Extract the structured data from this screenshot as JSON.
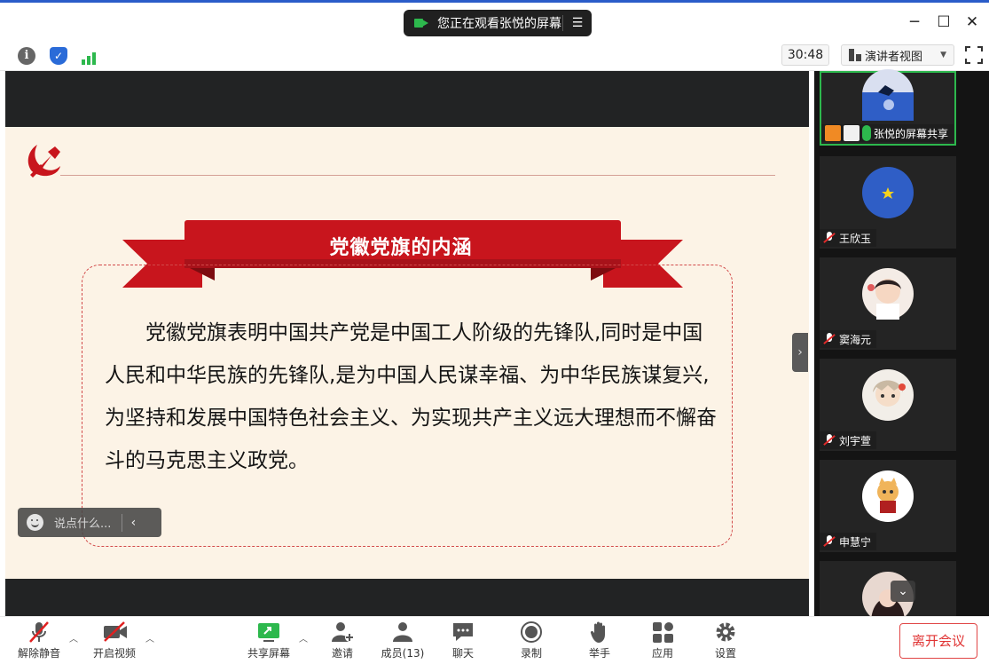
{
  "titlebar": {
    "share_banner": "您正在观看张悦的屏幕",
    "menu_icon": "menu-icon",
    "window_controls": [
      "minimize-icon",
      "maximize-icon",
      "close-icon"
    ]
  },
  "infobar": {
    "icons": [
      "info-icon",
      "shield-icon",
      "signal-icon"
    ],
    "elapsed": "30:48",
    "view_mode": "演讲者视图",
    "fullscreen_icon": "fullscreen-icon"
  },
  "slide": {
    "title": "党徽党旗的内涵",
    "body": "　　党徽党旗表明中国共产党是中国工人阶级的先锋队,同时是中国人民和中华民族的先锋队,是为中国人民谋幸福、为中华民族谋复兴,为坚持和发展中国特色社会主义、为实现共产主义远大理想而不懈奋斗的马克思主义政党。",
    "accent_color": "#c8151d"
  },
  "chat": {
    "placeholder": "说点什么..."
  },
  "participants": [
    {
      "name": "张悦的屏幕共享",
      "sharing": true
    },
    {
      "name": "王欣玉",
      "muted": true
    },
    {
      "name": "窦海元",
      "muted": true
    },
    {
      "name": "刘宇萱",
      "muted": true
    },
    {
      "name": "申慧宁",
      "muted": true
    }
  ],
  "toolbar": {
    "mute": "解除静音",
    "video": "开启视频",
    "share": "共享屏幕",
    "invite": "邀请",
    "members": "成员(13)",
    "chat": "聊天",
    "record": "录制",
    "raise_hand": "举手",
    "apps": "应用",
    "settings": "设置",
    "leave": "离开会议"
  }
}
